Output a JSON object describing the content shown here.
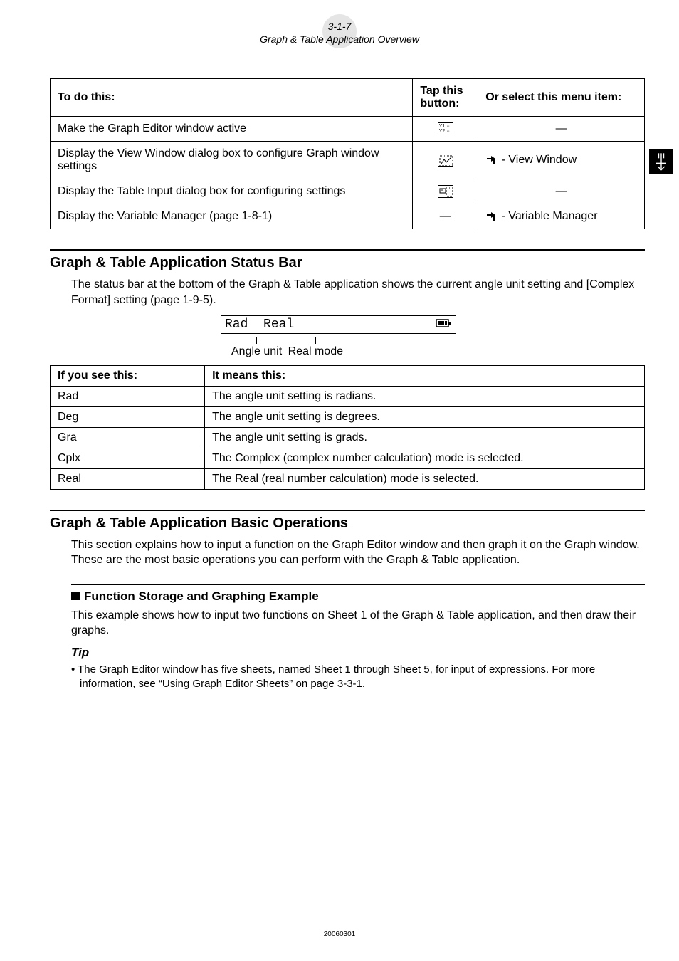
{
  "header": {
    "page_num": "3-1-7",
    "subtitle": "Graph & Table Application Overview"
  },
  "table1": {
    "headers": {
      "c1": "To do this:",
      "c2": "Tap this button:",
      "c3": "Or select this menu item:"
    },
    "rows": [
      {
        "todo": "Make the Graph Editor window active",
        "tap_icon": "y1y2-icon",
        "menu": "—"
      },
      {
        "todo": "Display the View Window dialog box to configure Graph window settings",
        "tap_icon": "viewwin-icon",
        "menu_icon": "hammer-icon",
        "menu_text": " - View Window"
      },
      {
        "todo": "Display the Table Input dialog box for configuring settings",
        "tap_icon": "tableinput-icon",
        "menu": "—"
      },
      {
        "todo": "Display the Variable Manager (page 1-8-1)",
        "tap": "—",
        "menu_icon": "hammer-icon",
        "menu_text": " - Variable Manager"
      }
    ]
  },
  "section_status": {
    "title": "Graph & Table Application Status Bar",
    "intro": "The status bar at the bottom of the Graph & Table application shows the current angle unit setting and [Complex Format] setting (page 1-9-5).",
    "lcd": {
      "left": "Rad",
      "mid": "Real"
    },
    "labels": {
      "a": "Angle unit",
      "b": "Real mode"
    }
  },
  "table2": {
    "headers": {
      "c1": "If you see this:",
      "c2": "It means this:"
    },
    "rows": [
      {
        "k": "Rad",
        "v": "The angle unit setting is radians."
      },
      {
        "k": "Deg",
        "v": "The angle unit setting is degrees."
      },
      {
        "k": "Gra",
        "v": "The angle unit setting is grads."
      },
      {
        "k": "Cplx",
        "v": "The Complex (complex number calculation) mode is selected."
      },
      {
        "k": "Real",
        "v": "The Real (real number calculation) mode is selected."
      }
    ]
  },
  "section_basic": {
    "title": "Graph & Table Application Basic Operations",
    "intro": "This section explains how to input a function on the Graph Editor window and then graph it on the Graph window. These are the most basic operations you can perform with the Graph & Table application."
  },
  "section_example": {
    "title": "Function Storage and Graphing Example",
    "intro": "This example shows how to input two functions on Sheet 1 of the Graph & Table application, and then draw their graphs.",
    "tip_label": "Tip",
    "tip_text": "• The Graph Editor window has five sheets, named Sheet 1 through Sheet 5, for input of expressions. For more information, see “Using Graph Editor Sheets” on page 3-3-1."
  },
  "footer": {
    "date": "20060301"
  }
}
